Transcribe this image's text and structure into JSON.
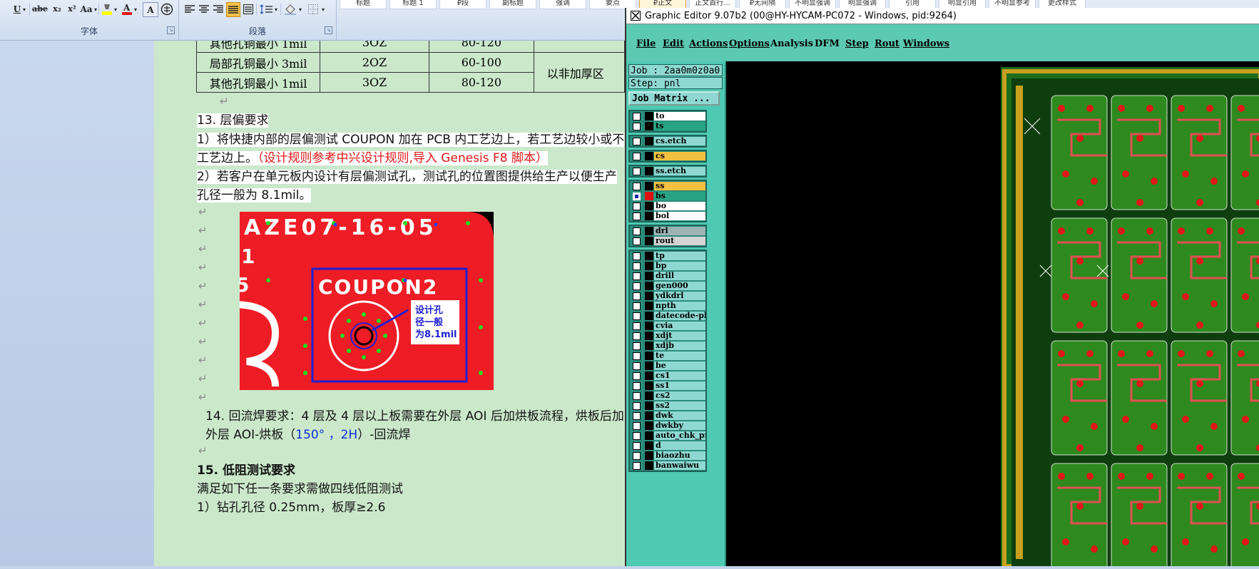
{
  "word": {
    "ribbon": {
      "font_group_label": "字体",
      "paragraph_group_label": "段落",
      "styles": [
        "标题",
        "标题 1",
        "₽段",
        "副标题",
        "强调",
        "要点",
        "₽正文",
        "正文首行...",
        "₽无间隔",
        "不明显强调",
        "明显强调",
        "引用",
        "明显引用",
        "不明显参考",
        "更改样式"
      ],
      "active_style_index": 6,
      "font_buttons": [
        "U",
        "abe",
        "x₂",
        "x²",
        "Aa",
        "A"
      ]
    },
    "table": {
      "rows": [
        {
          "label": "其他孔铜最小 1mil",
          "oz": "3OZ",
          "range": "80-120"
        },
        {
          "label": "局部孔铜最小 3mil",
          "oz": "2OZ",
          "range": "60-100"
        },
        {
          "label": "其他孔铜最小 1mil",
          "oz": "3OZ",
          "range": "80-120"
        }
      ],
      "merged_note": "以非加厚区"
    },
    "sec13": {
      "heading": "13. 层偏要求",
      "line1": "1）将快捷内部的层偏测试 COUPON  加在 PCB 内工艺边上，若工艺边较小或不",
      "line2_black": "工艺边上。",
      "line2_red": "（设计规则参考中兴设计规则,导入 Genesis F8 脚本）",
      "line3": "2）若客户在单元板内设计有层偏测试孔，测试孔的位置图提供给生产以便生产",
      "line4": "孔径一般为 8.1mil。"
    },
    "image": {
      "board_text": "AZE07-16-05",
      "side_digit_1": "1",
      "side_digit_2": "5",
      "coupon_label": "COUPON2",
      "callout_line1": "设计孔",
      "callout_line2": "径一般",
      "callout_line3": "为8.1mil"
    },
    "sec14": {
      "heading": "14. 回流焊要求：",
      "text1": "4 层及 4 层以上板需要在外层 AOI 后加烘板流程，烘板后加",
      "text2_a": "外层 AOI-烘板（",
      "text2_blue": "150° ，2H",
      "text2_b": "）-回流焊"
    },
    "sec15": {
      "heading": "15. 低阻测试要求",
      "line1": "满足如下任一条要求需做四线低阻测试",
      "line2": "1）钻孔孔径 0.25mm，板厚≥2.6"
    }
  },
  "graphic_editor": {
    "title": "Graphic Editor 9.07b2 (00@HY-HYCAM-PC072 - Windows, pid:9264)",
    "menu": [
      "File",
      "Edit",
      "Actions",
      "Options",
      "Analysis",
      "DFM",
      "Step",
      "Rout",
      "Windows"
    ],
    "job": "Job : 2aa0m0z0a0",
    "step": "Step: pnl",
    "job_matrix_button": "Job Matrix ...",
    "layer_groups": [
      [
        {
          "name": "to",
          "bg": "#ffffff",
          "swatch": "#000000"
        },
        {
          "name": "ts",
          "bg": "#27a484",
          "swatch": "#000000"
        }
      ],
      [
        {
          "name": "cs.etch",
          "bg": "#8fd8d2",
          "swatch": "#000000"
        }
      ],
      [
        {
          "name": "cs",
          "bg": "#f4c040",
          "swatch": "#000000"
        }
      ],
      [
        {
          "name": "ss.etch",
          "bg": "#8fd8d2",
          "swatch": "#000000"
        }
      ],
      [
        {
          "name": "ss",
          "bg": "#f4c040",
          "swatch": "#000000"
        },
        {
          "name": "bs",
          "bg": "#27a484",
          "swatch": "#e01010",
          "checked": true
        },
        {
          "name": "bo",
          "bg": "#ffffff",
          "swatch": "#000000"
        },
        {
          "name": "bol",
          "bg": "#ffffff",
          "swatch": "#000000"
        }
      ],
      [
        {
          "name": "drl",
          "bg": "#9eb4b4",
          "swatch": "#000000"
        },
        {
          "name": "rout",
          "bg": "#d4d4d4",
          "swatch": "#000000"
        }
      ],
      [
        {
          "name": "tp",
          "bg": "#8fd8d2",
          "swatch": "#000000"
        },
        {
          "name": "bp",
          "bg": "#8fd8d2",
          "swatch": "#000000"
        },
        {
          "name": "drill",
          "bg": "#8fd8d2",
          "swatch": "#000000"
        },
        {
          "name": "gen000",
          "bg": "#8fd8d2",
          "swatch": "#000000"
        },
        {
          "name": "ydkdrl",
          "bg": "#8fd8d2",
          "swatch": "#000000"
        },
        {
          "name": "npth",
          "bg": "#8fd8d2",
          "swatch": "#000000"
        },
        {
          "name": "datecode-pbe",
          "bg": "#8fd8d2",
          "swatch": "#000000"
        },
        {
          "name": "cvia",
          "bg": "#8fd8d2",
          "swatch": "#000000"
        },
        {
          "name": "xdjt",
          "bg": "#8fd8d2",
          "swatch": "#000000"
        },
        {
          "name": "xdjb",
          "bg": "#8fd8d2",
          "swatch": "#000000"
        },
        {
          "name": "te",
          "bg": "#8fd8d2",
          "swatch": "#000000"
        },
        {
          "name": "be",
          "bg": "#8fd8d2",
          "swatch": "#000000"
        },
        {
          "name": "cs1",
          "bg": "#8fd8d2",
          "swatch": "#000000"
        },
        {
          "name": "ss1",
          "bg": "#8fd8d2",
          "swatch": "#000000"
        },
        {
          "name": "cs2",
          "bg": "#8fd8d2",
          "swatch": "#000000"
        },
        {
          "name": "ss2",
          "bg": "#8fd8d2",
          "swatch": "#000000"
        },
        {
          "name": "dwk",
          "bg": "#8fd8d2",
          "swatch": "#000000"
        },
        {
          "name": "dwkby",
          "bg": "#8fd8d2",
          "swatch": "#000000"
        },
        {
          "name": "auto_chk_pn",
          "bg": "#8fd8d2",
          "swatch": "#000000"
        },
        {
          "name": "d",
          "bg": "#8fd8d2",
          "swatch": "#000000"
        },
        {
          "name": "biaozhu",
          "bg": "#8fd8d2",
          "swatch": "#000000"
        },
        {
          "name": "banwaiwu",
          "bg": "#8fd8d2",
          "swatch": "#000000"
        }
      ]
    ]
  }
}
